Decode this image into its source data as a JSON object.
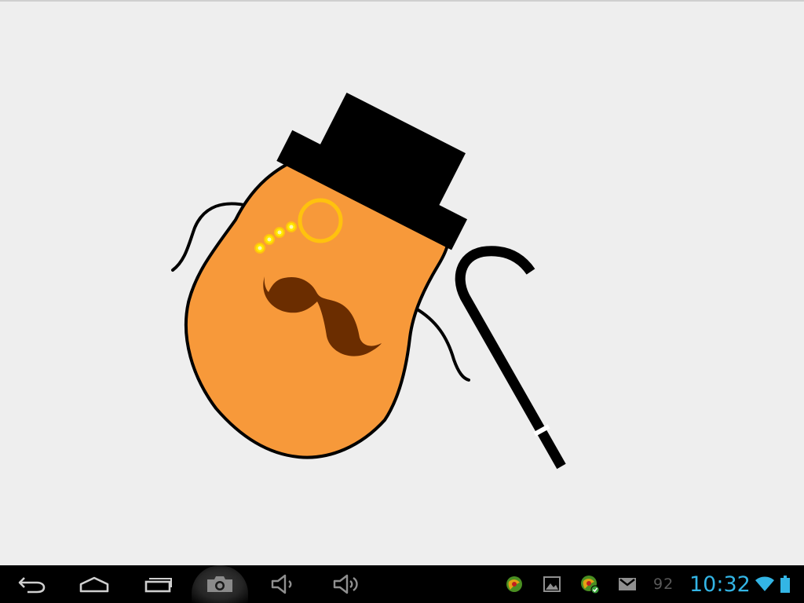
{
  "canvas": {
    "background": "#eeeeee",
    "drawing": {
      "body_color": "#f7993a",
      "outline_color": "#000000",
      "hat_color": "#000000",
      "monocle_color": "#ffc20e",
      "chain_color": "#ffea00",
      "mustache_color": "#6b2d00",
      "cane_color": "#000000",
      "cane_band_color": "#ffffff"
    }
  },
  "navigation_bar": {
    "background": "#000000",
    "buttons": [
      {
        "name": "back-icon"
      },
      {
        "name": "home-icon"
      },
      {
        "name": "recent-apps-icon"
      },
      {
        "name": "screenshot-camera-icon"
      },
      {
        "name": "volume-down-icon"
      },
      {
        "name": "volume-up-icon"
      }
    ]
  },
  "status_area": {
    "notification_icons": [
      "green-app-icon",
      "gallery-icon",
      "green-app-icon",
      "gmail-icon"
    ],
    "notification_count": "92",
    "time": "10:32",
    "time_color": "#33b5e5",
    "wifi_icon": "wifi-icon",
    "battery_icon": "battery-icon"
  }
}
